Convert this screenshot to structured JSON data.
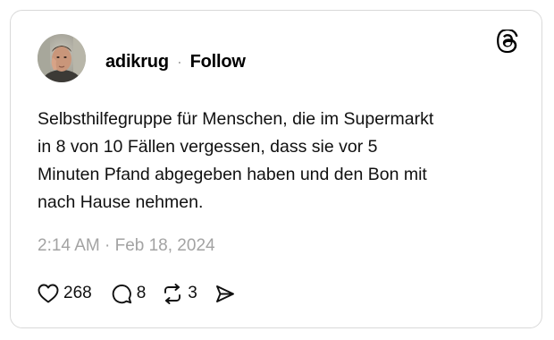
{
  "post": {
    "username": "adikrug",
    "separator": "·",
    "follow_label": "Follow",
    "text_lines": [
      "Selbsthilfegruppe für Menschen, die im Supermarkt",
      "in 8 von 10 Fällen vergessen, dass sie vor 5",
      "Minuten Pfand abgegeben haben und den Bon mit",
      "nach Hause nehmen."
    ],
    "timestamp": "2:14 AM · Feb 18, 2024",
    "likes": "268",
    "replies": "8",
    "reposts": "3"
  },
  "icons": {
    "logo": "threads-logo-icon",
    "like": "heart-icon",
    "reply": "speech-bubble-icon",
    "repost": "repost-arrows-icon",
    "share": "send-icon"
  },
  "colors": {
    "text": "#101010",
    "muted": "#a3a3a3",
    "border": "#d9d9d9"
  }
}
